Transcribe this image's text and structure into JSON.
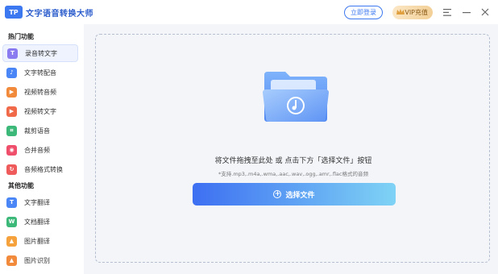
{
  "header": {
    "logo_text": "TP",
    "title": "文字语音转换大师",
    "login_label": "立即登录",
    "vip_label": "VIP充值",
    "menu_icon": "menu-icon",
    "minimize_icon": "minimize-icon",
    "close_icon": "close-icon"
  },
  "sidebar": {
    "hot_section": "热门功能",
    "other_section": "其他功能",
    "hot_items": [
      {
        "label": "录音转文字",
        "icon": "T",
        "color": "#8a7cf0",
        "active": true
      },
      {
        "label": "文字转配音",
        "icon": "♪",
        "color": "#4a86f5"
      },
      {
        "label": "视频转音频",
        "icon": "▶",
        "color": "#f28a3c"
      },
      {
        "label": "视频转文字",
        "icon": "▶",
        "color": "#f06a4a"
      },
      {
        "label": "裁剪语音",
        "icon": "⌗",
        "color": "#3cb878"
      },
      {
        "label": "合并音频",
        "icon": "◉",
        "color": "#ef4f6a"
      },
      {
        "label": "音频格式转换",
        "icon": "↻",
        "color": "#ef5a5a"
      }
    ],
    "other_items": [
      {
        "label": "文字翻译",
        "icon": "T",
        "color": "#4a86f5"
      },
      {
        "label": "文档翻译",
        "icon": "W",
        "color": "#3cb878"
      },
      {
        "label": "图片翻译",
        "icon": "▲",
        "color": "#f5a23c"
      },
      {
        "label": "图片识别",
        "icon": "▲",
        "color": "#f28a3c"
      }
    ]
  },
  "main": {
    "drop_text": "将文件拖拽至此处 或 点击下方「选择文件」按钮",
    "support_text": "*支持.mp3,.m4a,.wma,.aac,.wav,.ogg,.amr,.flac格式的音频",
    "select_button": "选择文件"
  }
}
